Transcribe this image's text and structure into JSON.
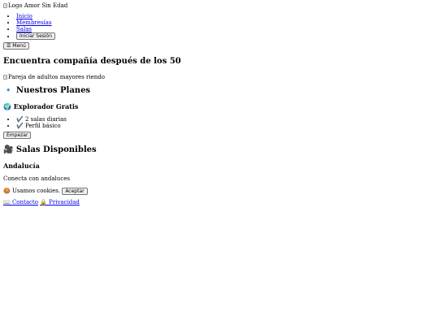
{
  "header": {
    "logo_alt": "Logo Amor Sin Edad",
    "nav": [
      {
        "label": "Inicio"
      },
      {
        "label": "Membresías"
      },
      {
        "label": "Salas"
      }
    ],
    "login_label": "Iniciar Sesión",
    "menu_label": "☰ Menú"
  },
  "hero": {
    "title": "Encuentra compañía después de los 50",
    "image_alt": "Pareja de adultos mayores riendo"
  },
  "plans": {
    "heading": "🔹 Nuestros Planes",
    "plan_title": "🌍 Explorador Gratis",
    "features": [
      "✔️ 2 salas diarias",
      "✔️ Perfil básico"
    ],
    "cta_label": "Empezar"
  },
  "rooms": {
    "heading": "🎥 Salas Disponibles",
    "room_title": "Andalucía",
    "room_desc": "Conecta con andaluces"
  },
  "cookies": {
    "text": "🍪 Usamos cookies.",
    "accept_label": "Aceptar"
  },
  "footer": {
    "contact_label": "📖 Contacto",
    "privacy_label": "🔒 Privacidad"
  }
}
